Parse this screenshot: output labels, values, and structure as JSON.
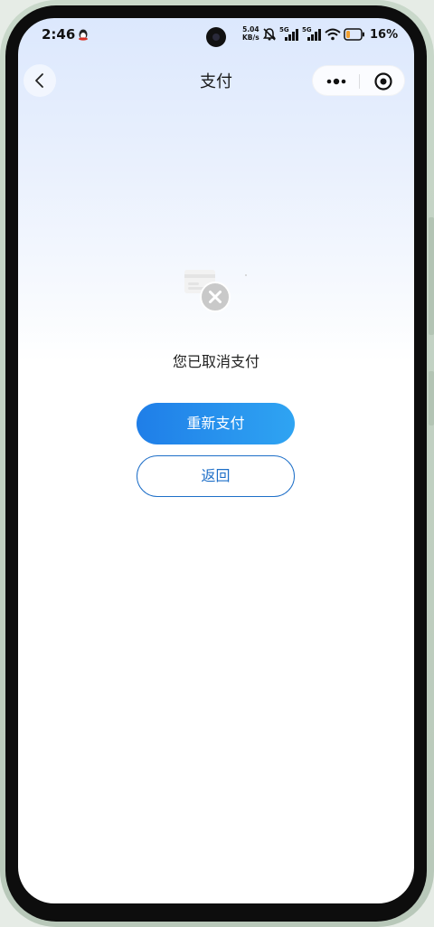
{
  "status_bar": {
    "time": "2:46",
    "net_speed_value": "5.04",
    "net_speed_unit": "KB/s",
    "signal_1_label": "5G",
    "signal_2_label": "5G",
    "battery_percent": "16%"
  },
  "nav": {
    "title": "支付"
  },
  "result": {
    "message": "您已取消支付"
  },
  "buttons": {
    "repay_label": "重新支付",
    "back_label": "返回"
  },
  "colors": {
    "primary_blue": "#1f7ee8",
    "primary_blue_end": "#2fa4f2",
    "outline_blue": "#1e6fc8",
    "battery_low": "#f0a030"
  },
  "icons": {
    "back": "chevron-left-icon",
    "more": "more-dots-icon",
    "close_miniprogram": "target-circle-icon",
    "status": "cancel-x-icon"
  }
}
